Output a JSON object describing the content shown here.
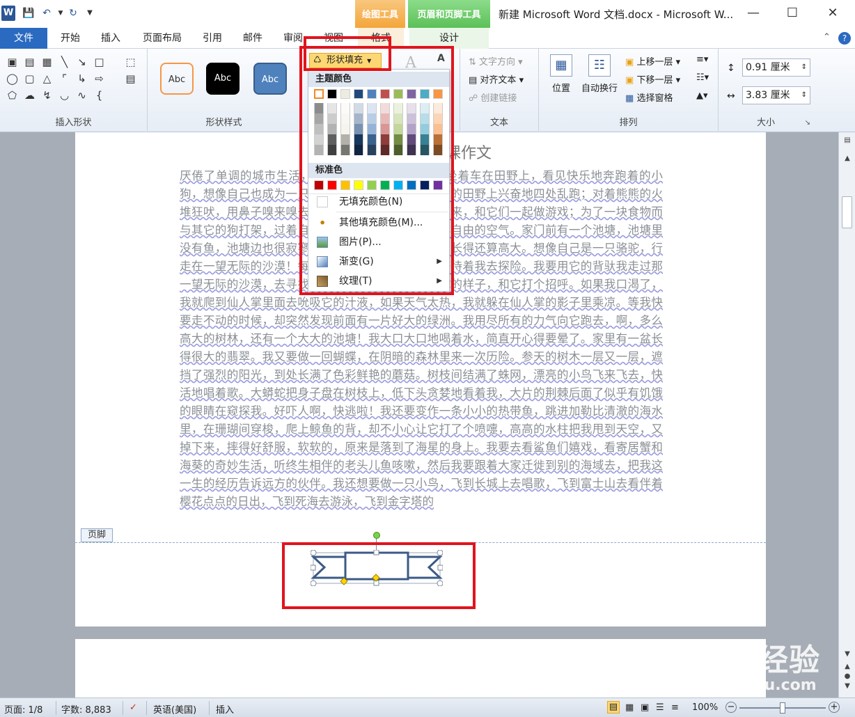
{
  "app": {
    "window_title": "新建 Microsoft Word 文档.docx - Microsoft W...",
    "context_tab_drawing": "绘图工具",
    "context_tab_header_footer": "页眉和页脚工具"
  },
  "tabs": {
    "file": "文件",
    "home": "开始",
    "insert": "插入",
    "page_layout": "页面布局",
    "references": "引用",
    "mailings": "邮件",
    "review": "审阅",
    "view": "视图",
    "format": "格式",
    "design": "设计"
  },
  "ribbon": {
    "insert_shapes_label": "插入形状",
    "shape_styles_label": "形状样式",
    "style_sample": "Abc",
    "shape_fill": "形状填充",
    "text_direction": "文字方向",
    "align_text": "对齐文本",
    "create_link": "创建链接",
    "text_group_label": "文本",
    "position": "位置",
    "wrap_text": "自动换行",
    "bring_forward": "上移一层",
    "send_backward": "下移一层",
    "selection_pane": "选择窗格",
    "arrange_label": "排列",
    "height_value": "0.91 厘米",
    "width_value": "3.83 厘米",
    "size_label": "大小"
  },
  "fill_menu": {
    "theme_colors": "主题颜色",
    "standard_colors": "标准色",
    "no_fill": "无填充颜色(N)",
    "more_colors": "其他填充颜色(M)...",
    "picture": "图片(P)...",
    "gradient": "渐变(G)",
    "texture": "纹理(T)",
    "theme_row": [
      "#ffffff",
      "#000000",
      "#eeece1",
      "#1f497d",
      "#4f81bd",
      "#c0504d",
      "#9bbb59",
      "#8064a2",
      "#4bacc6",
      "#f79646"
    ],
    "standard_row": [
      "#c00000",
      "#ff0000",
      "#ffc000",
      "#ffff00",
      "#92d050",
      "#00b050",
      "#00b0f0",
      "#0070c0",
      "#002060",
      "#7030a0"
    ]
  },
  "document": {
    "title": "课作文",
    "body": "厌倦了单调的城市生活，我想象自己是一只小狗，坐着车在田野上，看见快乐地奔跑着的小狗，想像自己也成为一只小狗，在那个宽阔但也很大的田野上兴奋地四处乱跑；对着熊熊的火堆狂吠，用鼻子嗅来嗅去，钻进老鼠洞，把老鼠赶出来，和它们一起做游戏；为了一块食物而与其它的狗打架，过着自由的生活，到处充满了新鲜自由的空气。家门前有一个池塘，池塘里没有鱼，池塘边也很寂寥，只有几株不知名的植物，长得还算高大。想像自己是一只骆驼，行走在一望无际的沙漠！每一处都那么新奇与神秘，等待着我去探险。我要用它的背驮我走过那一望无际的沙漠，去寻找沙漠中的绿洲，看一看骆驼的样子，和它打个招呼。如果我口渴了，我就爬到仙人掌里面去吮吸它的汁液，如果天气太热，我就躲在仙人掌的影子里乘凉。等我快要走不动的时候，却突然发现前面有一片好大的绿洲。我用尽所有的力气向它跑去，啊，多么高大的树林，还有一个大大的池塘！我大口大口地喝着水，简直开心得要晕了。家里有一盆长得很大的翡翠。我又要做一回蝴蝶，在阴暗的森林里来一次历险。参天的树木一层又一层，遮挡了强烈的阳光，到处长满了色彩鲜艳的蘑菇。树枝间结满了蛛网，漂亮的小鸟飞来飞去，快活地唱着歌。大蟒蛇把身子盘在树枝上，低下头贪婪地看着我，大片的荆棘后面了似乎有饥饿的眼睛在窥探我。好吓人啊，快逃啦！我还要变作一条小小的热带鱼，跳进加勒比清澈的海水里，在珊瑚间穿梭，爬上鲸鱼的背，却不小心让它打了个喷嚏，高高的水柱把我甩到天空，又掉下来，摔得好舒服，软软的，原来是落到了海星的身上。我要去看鲨鱼们嬉戏，看寄居蟹和海葵的奇妙生活，听终生相伴的老头儿鱼咳嗽，然后我要跟着大家迁徙到别的海域去，把我这一生的经历告诉远方的伙伴。我还想要做一只小鸟，飞到长城上去唱歌，飞到富士山去看伴着樱花点点的日出，飞到死海去游泳，飞到金字塔的",
    "footer_tag": "页脚"
  },
  "status": {
    "page": "页面: 1/8",
    "words": "字数: 8,883",
    "language": "英语(美国)",
    "mode": "插入",
    "zoom": "100%"
  },
  "watermark": {
    "main": "Baidu经验",
    "sub": "jingyan.baidu.com"
  }
}
